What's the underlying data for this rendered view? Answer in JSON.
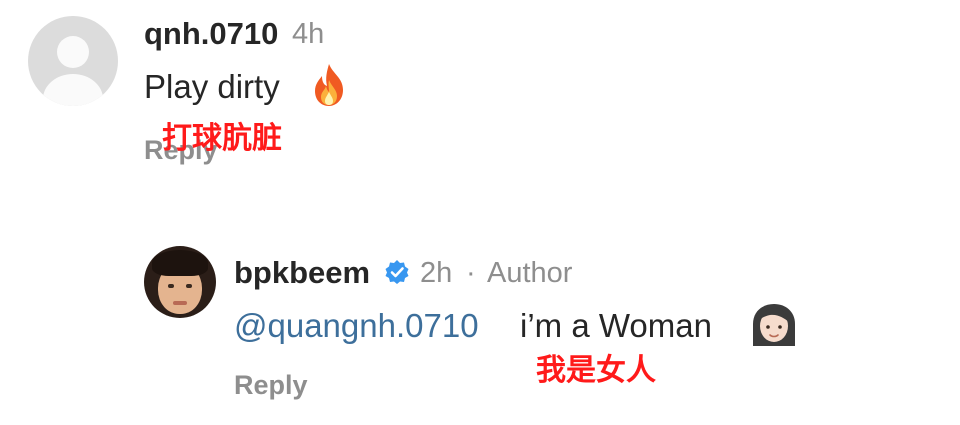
{
  "comment": {
    "username": "qnh.0710",
    "time": "4h",
    "text": "Play dirty",
    "emoji": "fire-emoji",
    "translation": "打球肮脏",
    "reply_label": "Reply"
  },
  "reply_comment": {
    "username": "bpkbeem",
    "time": "2h",
    "separator": "·",
    "author_label": "Author",
    "mention": "@quangnh.0710",
    "text": "i’m a Woman",
    "emoji": "woman-emoji",
    "translation": "我是女人",
    "reply_label": "Reply"
  }
}
